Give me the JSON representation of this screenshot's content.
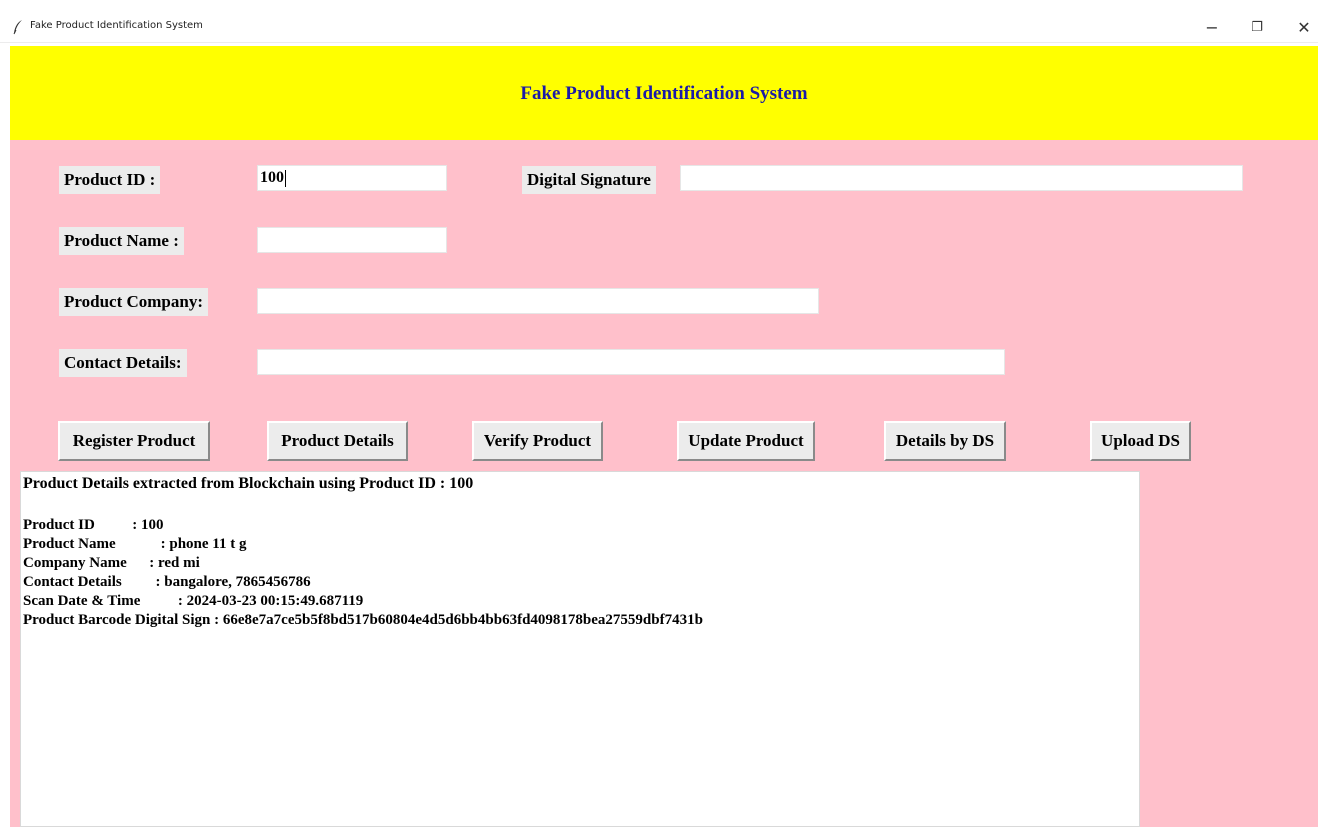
{
  "window": {
    "title": "Fake Product Identification System",
    "controls": {
      "minimize": "−",
      "maximize": "❐",
      "close": "✕"
    }
  },
  "header": {
    "title": "Fake Product Identification System",
    "background": "#ffff00",
    "title_color": "#1a1aa8"
  },
  "panel": {
    "background": "#ffc0cb"
  },
  "form": {
    "product_id": {
      "label": "Product ID :",
      "value": "100"
    },
    "digital_signature": {
      "label": "Digital Signature",
      "value": ""
    },
    "product_name": {
      "label": "Product Name :",
      "value": ""
    },
    "product_company": {
      "label": "Product Company:",
      "value": ""
    },
    "contact_details": {
      "label": "Contact Details:",
      "value": ""
    }
  },
  "buttons": {
    "register": "Register Product",
    "details": "Product Details",
    "verify": "Verify Product",
    "update": "Update Product",
    "details_by_ds": "Details by DS",
    "upload_ds": "Upload DS"
  },
  "output": {
    "heading": "Product Details extracted from Blockchain using Product ID : 100",
    "lines": [
      "Product ID          : 100",
      "Product Name            : phone 11 t g",
      "Company Name      : red mi",
      "Contact Details         : bangalore, 7865456786",
      "Scan Date & Time          : 2024-03-23 00:15:49.687119",
      "Product Barcode Digital Sign : 66e8e7a7ce5b5f8bd517b60804e4d5d6bb4bb63fd4098178bea27559dbf7431b"
    ]
  }
}
